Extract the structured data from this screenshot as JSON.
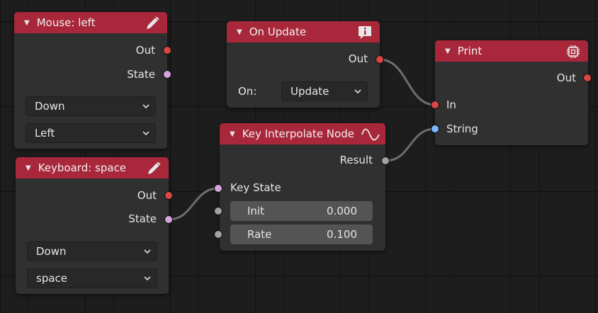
{
  "nodes": {
    "mouse": {
      "title": "Mouse: left",
      "out_label": "Out",
      "state_label": "State",
      "select1": "Down",
      "select2": "Left",
      "icon": "pencil-icon"
    },
    "keyboard": {
      "title": "Keyboard: space",
      "out_label": "Out",
      "state_label": "State",
      "select1": "Down",
      "select2": "space",
      "icon": "pencil-icon"
    },
    "on_update": {
      "title": "On Update",
      "out_label": "Out",
      "on_label": "On:",
      "on_value": "Update",
      "icon": "info-icon"
    },
    "key_interpolate": {
      "title": "Key Interpolate Node",
      "result_label": "Result",
      "key_state_label": "Key State",
      "init_label": "Init",
      "init_value": "0.000",
      "rate_label": "Rate",
      "rate_value": "0.100",
      "icon": "curve-icon"
    },
    "print": {
      "title": "Print",
      "out_label": "Out",
      "in_label": "In",
      "string_label": "String",
      "icon": "chip-icon"
    }
  },
  "colors": {
    "header": "#a8273a",
    "node_body": "#303030",
    "socket_red": "#d94646",
    "socket_pink": "#d6a3e0",
    "socket_gray": "#a1a1a1",
    "socket_blue": "#7bb8ff",
    "link": "#7a7a7a"
  }
}
